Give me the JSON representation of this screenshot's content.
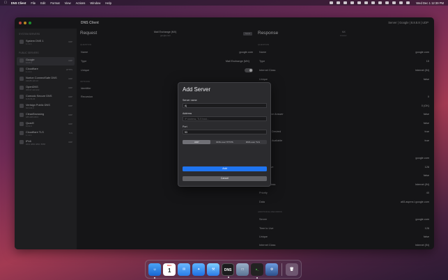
{
  "menubar": {
    "app": "DNS Client",
    "items": [
      "File",
      "Edit",
      "Format",
      "View",
      "Actions",
      "Window",
      "Help"
    ],
    "clock": "Wed Dec 1 12:39 PM"
  },
  "window": {
    "title": "DNS Client",
    "server": "Server | Google | 8.8.8.8 | UDP"
  },
  "sidebar": {
    "sections": [
      {
        "header": "SYSTEM SERVERS",
        "items": [
          {
            "name": "System DNS 1",
            "sub": "1.1.1.1",
            "tag": "UDP"
          }
        ]
      },
      {
        "header": "PUBLIC SERVERS",
        "items": [
          {
            "name": "Google",
            "sub": "8.8.8.8",
            "tag": "UDP",
            "selected": true
          },
          {
            "name": "Cloudflare",
            "sub": "1.1.1.1",
            "tag": "HTTPS"
          },
          {
            "name": "Norton ConnectSafe DNS",
            "sub": "199.85.126.10",
            "tag": "UDP"
          },
          {
            "name": "OpenDNS",
            "sub": "208.67.222.222",
            "tag": "UDP"
          },
          {
            "name": "Comodo Secure DNS",
            "sub": "8.26.56.26",
            "tag": "UDP"
          },
          {
            "name": "Verisign Public DNS",
            "sub": "64.6.64.6",
            "tag": "UDP"
          },
          {
            "name": "CleanBrowsing",
            "sub": "185.228.168.9",
            "tag": "UDP"
          },
          {
            "name": "Quad9",
            "sub": "9.9.9.9",
            "tag": "UDP"
          },
          {
            "name": "Cloudflare TLS",
            "sub": "1.1.1.1",
            "tag": "TLS"
          },
          {
            "name": "IPv6",
            "sub": "2001:4860:4860::8888",
            "tag": "UDP"
          }
        ]
      }
    ]
  },
  "request": {
    "title": "Request",
    "header_title": "Mail Exchange (MX)",
    "header_sub": "google.com",
    "send": "Send",
    "section_question": "QUESTION",
    "section_options": "OPTIONS",
    "name_label": "Name",
    "name_value": "google.com",
    "type_label": "Type",
    "type_value": "Mail Exchange (MX)",
    "unique_label": "Unique",
    "identifier_label": "Identifier",
    "recursion_label": "Recursion"
  },
  "response": {
    "title": "Response",
    "badge": "MX",
    "badge_sub": "Answer",
    "section_question": "QUESTION",
    "section_answer": "ANSWER",
    "section_additional": "ADDITIONAL RECORDS",
    "rows": [
      {
        "k": "Name",
        "v": "google.com"
      },
      {
        "k": "Type",
        "v": "15"
      },
      {
        "k": "Internet Class",
        "v": "Internet (IN)"
      },
      {
        "k": "Unique",
        "v": "false"
      },
      {
        "k": "",
        "v": "0"
      },
      {
        "k": "Code",
        "v": "0 (OK)"
      },
      {
        "k": "Authoritative Answer",
        "v": "false"
      },
      {
        "k": "Truncated",
        "v": "false"
      },
      {
        "k": "Recursion Desired",
        "v": "true"
      },
      {
        "k": "Recursion Available",
        "v": "true"
      },
      {
        "k": "Name",
        "v": "google.com"
      },
      {
        "k": "Time to Live",
        "v": "126"
      },
      {
        "k": "Unique",
        "v": "false"
      },
      {
        "k": "Internet Class",
        "v": "Internet (IN)"
      },
      {
        "k": "Priority",
        "v": "40"
      },
      {
        "k": "Data",
        "v": "alt3.aspmx.l.google.com"
      },
      {
        "k": "Server",
        "v": "google.com"
      },
      {
        "k": "Time to Live",
        "v": "126"
      },
      {
        "k": "Unique",
        "v": "false"
      },
      {
        "k": "Internet Class",
        "v": "Internet (IN)"
      }
    ]
  },
  "modal": {
    "title": "Add Server",
    "name_label": "Server name",
    "name_value": "A|",
    "address_label": "Address",
    "address_placeholder": "IP Address, TLS host...",
    "port_label": "Port",
    "port_value": "53",
    "segments": [
      "UDP",
      "DNS over HTTPS",
      "DNS over TLS"
    ],
    "segment_selected": 0,
    "add": "Add",
    "cancel": "Cancel"
  },
  "dock": {
    "calendar_month": "DEC",
    "calendar_day": "1",
    "dns_label": "DNS"
  },
  "colors": {
    "accent": "#1f74f0",
    "window_bg": "#1e1e20",
    "sidebar_bg": "#2a2a2d"
  }
}
